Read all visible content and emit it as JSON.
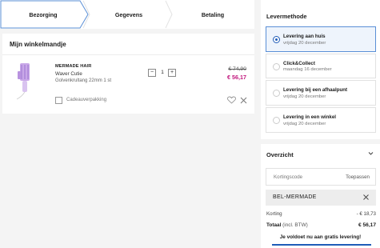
{
  "steps": {
    "items": [
      {
        "label": "Bezorging"
      },
      {
        "label": "Gegevens"
      },
      {
        "label": "Betaling"
      }
    ]
  },
  "cart": {
    "title": "Mijn winkelmandje",
    "product": {
      "brand": "MERMADE HAIR",
      "name": "Waver Cutie",
      "variant": "Golvenkrultang 22mm 1 st",
      "quantity": "1",
      "qty_minus": "−",
      "qty_plus": "+",
      "price_old": "€ 74,90",
      "price_new": "€ 56,17",
      "gift_label": "Cadeauverpakking"
    }
  },
  "delivery": {
    "title": "Levermethode",
    "options": [
      {
        "label": "Levering aan huis",
        "date": "vrijdag 20 december",
        "selected": true
      },
      {
        "label": "Click&Collect",
        "date": "maandag 16 december",
        "selected": false
      },
      {
        "label": "Levering bij een afhaalpunt",
        "date": "vrijdag 20 december",
        "selected": false
      },
      {
        "label": "Levering in een winkel",
        "date": "vrijdag 20 december",
        "selected": false
      }
    ]
  },
  "overview": {
    "title": "Overzicht",
    "coupon_placeholder": "Kortingscode",
    "coupon_apply": "Toepassen",
    "applied_code": "BEL-MERMADE",
    "discount_label": "Korting",
    "discount_value": "- € 18,73",
    "total_label": "Totaal",
    "total_incl": "(incl. BTW)",
    "total_value": "€ 56,17",
    "free_shipping": "Je voldoet nu aan gratis levering!",
    "free_shipping_progress": 1.0
  },
  "colors": {
    "accent": "#1f5cb8",
    "price_sale": "#c2187e",
    "selected_bg": "#eef4fc"
  }
}
